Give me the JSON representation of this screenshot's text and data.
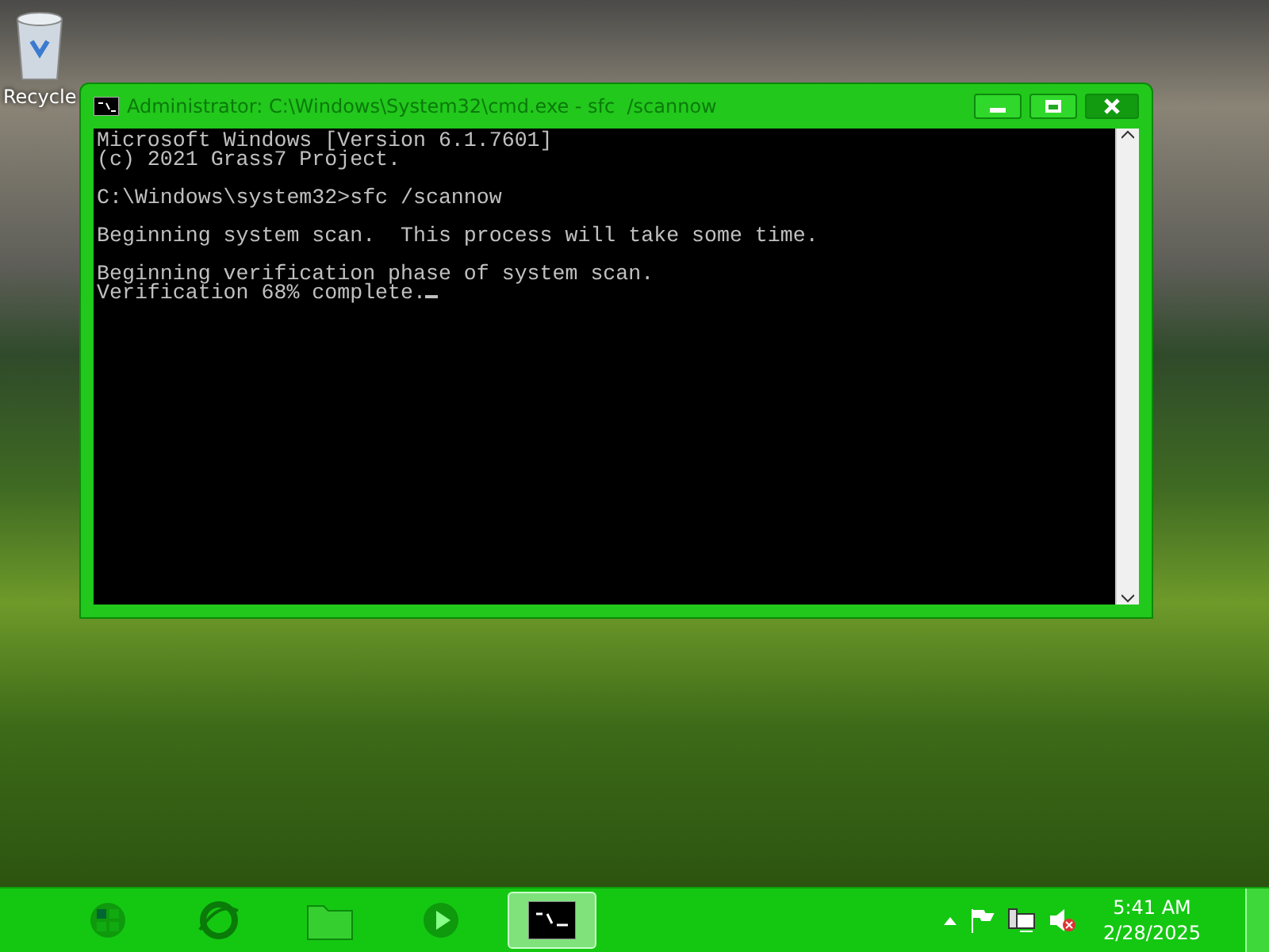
{
  "desktop": {
    "icons": [
      {
        "label": "Recycle"
      }
    ]
  },
  "window": {
    "title": "Administrator: C:\\Windows\\System32\\cmd.exe - sfc  /scannow",
    "active": true,
    "console": {
      "blocks": [
        [
          "Microsoft Windows [Version 6.1.7601]",
          "(c) 2021 Grass7 Project."
        ],
        [
          "C:\\Windows\\system32>sfc /scannow"
        ],
        [
          "Beginning system scan.  This process will take some time."
        ],
        [
          "Beginning verification phase of system scan.",
          "Verification 68% complete."
        ]
      ],
      "cursor_visible": true
    }
  },
  "taskbar": {
    "items": [
      {
        "kind": "start",
        "selected": false
      },
      {
        "kind": "browser",
        "selected": false
      },
      {
        "kind": "folder",
        "selected": false
      },
      {
        "kind": "media",
        "selected": false
      },
      {
        "kind": "console",
        "selected": true
      }
    ],
    "tray": [
      {
        "kind": "overflow"
      },
      {
        "kind": "flag"
      },
      {
        "kind": "network"
      },
      {
        "kind": "volume",
        "muted": true
      }
    ],
    "clock": {
      "time": "5:41 AM",
      "date": "2/28/2025"
    }
  }
}
